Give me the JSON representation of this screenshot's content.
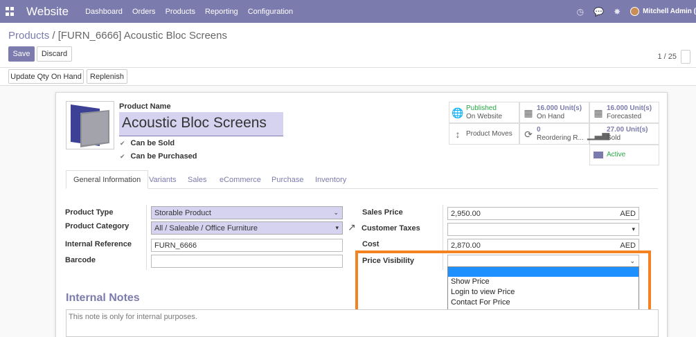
{
  "app": {
    "name": "Website",
    "menu": [
      "Dashboard",
      "Orders",
      "Products",
      "Reporting",
      "Configuration"
    ],
    "user": "Mitchell Admin ("
  },
  "breadcrumb": {
    "parent": "Products",
    "current": "[FURN_6666] Acoustic Bloc Screens"
  },
  "actions": {
    "save": "Save",
    "discard": "Discard",
    "update_qty": "Update Qty On Hand",
    "replenish": "Replenish"
  },
  "pager": {
    "text": "1 / 25"
  },
  "product": {
    "name_label": "Product Name",
    "name": "Acoustic Bloc Screens",
    "can_be_sold": "Can be Sold",
    "can_be_purchased": "Can be Purchased"
  },
  "stats": {
    "published": {
      "line1": "Published",
      "line2": "On Website"
    },
    "on_hand": {
      "value": "16.000",
      "unit": "Unit(s)",
      "label": "On Hand"
    },
    "forecasted": {
      "value": "16.000",
      "unit": "Unit(s)",
      "label": "Forecasted"
    },
    "moves": {
      "label": "Product Moves"
    },
    "reordering": {
      "value": "0",
      "label": "Reordering R..."
    },
    "sold": {
      "value": "27.00",
      "unit": "Unit(s)",
      "label": "Sold"
    },
    "active": {
      "label": "Active"
    }
  },
  "tabs": [
    "General Information",
    "Variants",
    "Sales",
    "eCommerce",
    "Purchase",
    "Inventory"
  ],
  "form": {
    "product_type_label": "Product Type",
    "product_type": "Storable Product",
    "category_label": "Product Category",
    "category": "All / Saleable / Office Furniture",
    "ref_label": "Internal Reference",
    "ref": "FURN_6666",
    "barcode_label": "Barcode",
    "barcode": "",
    "sales_price_label": "Sales Price",
    "sales_price": "2,950.00",
    "currency": "AED",
    "taxes_label": "Customer Taxes",
    "cost_label": "Cost",
    "cost": "2,870.00",
    "price_visibility_label": "Price Visibility"
  },
  "dropdown": {
    "options": [
      "Show Price",
      "Login to view Price",
      "Contact For Price"
    ]
  },
  "notes": {
    "title": "Internal Notes",
    "placeholder": "This note is only for internal purposes."
  },
  "colors": {
    "brand": "#7c7bad",
    "highlight": "#f58220",
    "required": "#d5d3f0",
    "selected": "#1e90ff"
  }
}
